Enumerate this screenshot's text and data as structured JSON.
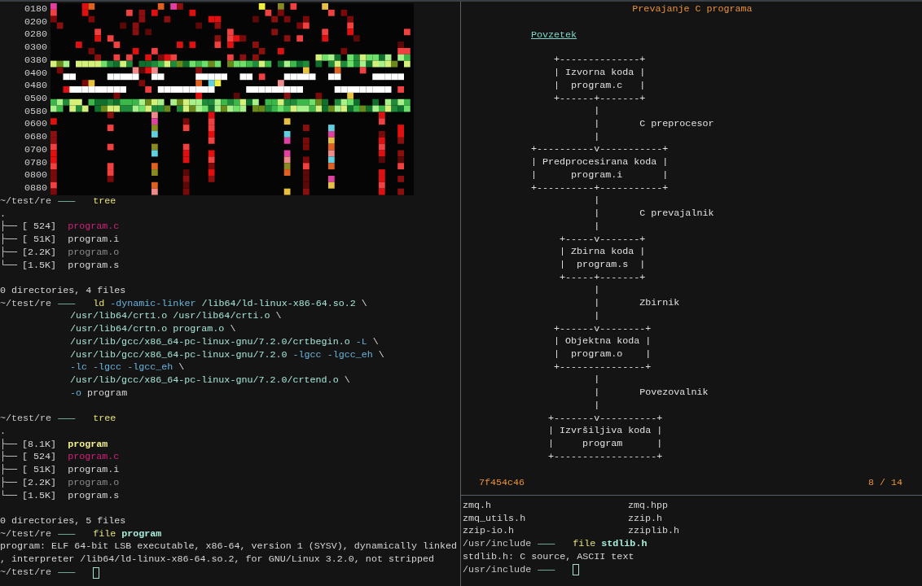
{
  "left_terminal": {
    "byte_map": {
      "row_labels": [
        "0180",
        "0200",
        "0280",
        "0300",
        "0380",
        "0400",
        "0480",
        "0500",
        "0580",
        "0600",
        "0680",
        "0700",
        "0780",
        "0800",
        "0880"
      ]
    },
    "lines": [
      {
        "kind": "prompt",
        "path": "~/test/re",
        "separator": "———",
        "cursor": false,
        "segments": [
          {
            "text": "tree",
            "kind": "command"
          }
        ]
      },
      {
        "kind": "output",
        "text": "."
      },
      {
        "kind": "tree",
        "branch": "├──",
        "size": "[ 524]",
        "file": {
          "name": "program.c",
          "kind": "source"
        }
      },
      {
        "kind": "tree",
        "branch": "├──",
        "size": "[ 51K]",
        "file": {
          "name": "program.i",
          "kind": "text"
        }
      },
      {
        "kind": "tree",
        "branch": "├──",
        "size": "[2.2K]",
        "file": {
          "name": "program.o",
          "kind": "object"
        }
      },
      {
        "kind": "tree",
        "branch": "└──",
        "size": "[1.5K]",
        "file": {
          "name": "program.s",
          "kind": "text"
        }
      },
      {
        "kind": "blank"
      },
      {
        "kind": "output",
        "text": "0 directories, 4 files"
      },
      {
        "kind": "prompt",
        "path": "~/test/re",
        "separator": "———",
        "cursor": false,
        "segments": [
          {
            "text": "ld",
            "kind": "command"
          },
          {
            "text": "-dynamic-linker",
            "kind": "option"
          },
          {
            "text": "/lib64/ld-linux-x86-64.so.2",
            "kind": "path"
          },
          {
            "text": "\\",
            "kind": "plain"
          }
        ]
      },
      {
        "kind": "continuation",
        "segments": [
          {
            "text": "/usr/lib64/crt1.o /usr/lib64/crti.o",
            "kind": "path"
          },
          {
            "text": "\\",
            "kind": "plain"
          }
        ]
      },
      {
        "kind": "continuation",
        "segments": [
          {
            "text": "/usr/lib64/crtn.o program.o",
            "kind": "path"
          },
          {
            "text": "\\",
            "kind": "plain"
          }
        ]
      },
      {
        "kind": "continuation",
        "segments": [
          {
            "text": "/usr/lib/gcc/x86_64-pc-linux-gnu/7.2.0/crtbegin.o",
            "kind": "path"
          },
          {
            "text": "-L",
            "kind": "option"
          },
          {
            "text": "\\",
            "kind": "plain"
          }
        ]
      },
      {
        "kind": "continuation",
        "segments": [
          {
            "text": "/usr/lib/gcc/x86_64-pc-linux-gnu/7.2.0",
            "kind": "path"
          },
          {
            "text": "-lgcc -lgcc_eh",
            "kind": "option"
          },
          {
            "text": "\\",
            "kind": "plain"
          }
        ]
      },
      {
        "kind": "continuation",
        "segments": [
          {
            "text": "-lc -lgcc -lgcc_eh",
            "kind": "option"
          },
          {
            "text": "\\",
            "kind": "plain"
          }
        ]
      },
      {
        "kind": "continuation",
        "segments": [
          {
            "text": "/usr/lib/gcc/x86_64-pc-linux-gnu/7.2.0/crtend.o",
            "kind": "path"
          },
          {
            "text": "\\",
            "kind": "plain"
          }
        ]
      },
      {
        "kind": "continuation",
        "segments": [
          {
            "text": "-o",
            "kind": "option"
          },
          {
            "text": "program",
            "kind": "plain"
          }
        ]
      },
      {
        "kind": "blank"
      },
      {
        "kind": "prompt",
        "path": "~/test/re",
        "separator": "———",
        "cursor": false,
        "segments": [
          {
            "text": "tree",
            "kind": "command"
          }
        ]
      },
      {
        "kind": "output",
        "text": "."
      },
      {
        "kind": "tree",
        "branch": "├──",
        "size": "[8.1K]",
        "file": {
          "name": "program",
          "kind": "executable"
        }
      },
      {
        "kind": "tree",
        "branch": "├──",
        "size": "[ 524]",
        "file": {
          "name": "program.c",
          "kind": "source"
        }
      },
      {
        "kind": "tree",
        "branch": "├──",
        "size": "[ 51K]",
        "file": {
          "name": "program.i",
          "kind": "text"
        }
      },
      {
        "kind": "tree",
        "branch": "├──",
        "size": "[2.2K]",
        "file": {
          "name": "program.o",
          "kind": "object"
        }
      },
      {
        "kind": "tree",
        "branch": "└──",
        "size": "[1.5K]",
        "file": {
          "name": "program.s",
          "kind": "text"
        }
      },
      {
        "kind": "blank"
      },
      {
        "kind": "output",
        "text": "0 directories, 5 files"
      },
      {
        "kind": "prompt",
        "path": "~/test/re",
        "separator": "———",
        "cursor": false,
        "segments": [
          {
            "text": "file",
            "kind": "command"
          },
          {
            "text": "program",
            "kind": "argument"
          }
        ]
      },
      {
        "kind": "output",
        "text": "program: ELF 64-bit LSB executable, x86-64, version 1 (SYSV), dynamically linked"
      },
      {
        "kind": "output",
        "text": ", interpreter /lib64/ld-linux-x86-64.so.2, for GNU/Linux 3.2.0, not stripped"
      },
      {
        "kind": "prompt",
        "path": "~/test/re",
        "separator": "———",
        "cursor": true
      }
    ]
  },
  "slide_pane": {
    "title": "Prevajanje C programa",
    "link": "Povzetek",
    "diagram": [
      "    +--------------+",
      "    | Izvorna koda |",
      "    |  program.c   |",
      "    +------+-------+",
      "           |",
      "           |       C preprocesor",
      "           |",
      "+----------v-----------+",
      "| Predprocesirana koda |",
      "|      program.i       |",
      "+----------+-----------+",
      "           |",
      "           |       C prevajalnik",
      "           |",
      "     +-----v-------+",
      "     | Zbirna koda |",
      "     |  program.s  |",
      "     +-----+-------+",
      "           |",
      "           |       Zbirnik",
      "           |",
      "    +------v--------+",
      "    | Objektna koda |",
      "    |  program.o    |",
      "    +---------------+",
      "           |",
      "           |       Povezovalnik",
      "           |",
      "   +-------v----------+",
      "   | Izvršiljiva koda |",
      "   |     program      |",
      "   +------------------+"
    ],
    "status_left": "7f454c46",
    "status_right": "8 / 14"
  },
  "bottom_terminal": {
    "lines": [
      {
        "kind": "columns",
        "cells": [
          "zmq.h",
          "zmq.hpp"
        ]
      },
      {
        "kind": "columns",
        "cells": [
          "zmq_utils.h",
          "zzip.h"
        ]
      },
      {
        "kind": "columns",
        "cells": [
          "zzip-io.h",
          "zziplib.h"
        ]
      },
      {
        "kind": "prompt",
        "path": "/usr/include",
        "separator": "———",
        "cursor": false,
        "segments": [
          {
            "text": "file",
            "kind": "command"
          },
          {
            "text": "stdlib.h",
            "kind": "argument"
          }
        ]
      },
      {
        "kind": "output",
        "text": "stdlib.h: C source, ASCII text"
      },
      {
        "kind": "prompt",
        "path": "/usr/include",
        "separator": "———",
        "cursor": true
      }
    ]
  }
}
